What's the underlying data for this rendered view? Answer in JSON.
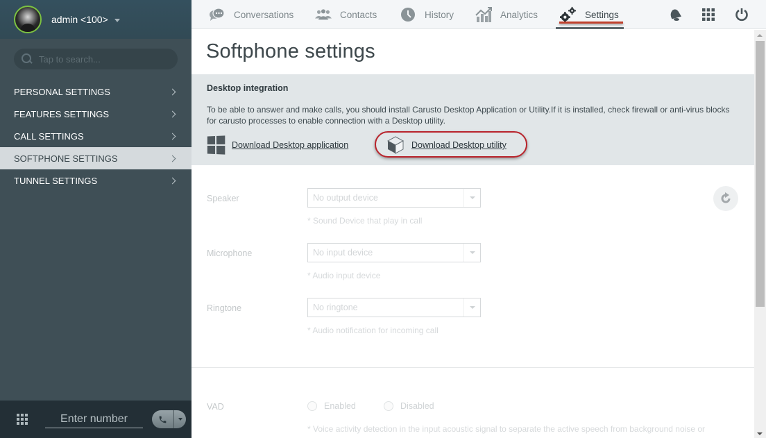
{
  "user": {
    "name": "admin <100>",
    "status_color": "#7cc242"
  },
  "search": {
    "placeholder": "Tap to search..."
  },
  "sidebar": {
    "items": [
      {
        "label": "PERSONAL SETTINGS",
        "active": false
      },
      {
        "label": "FEATURES SETTINGS",
        "active": false
      },
      {
        "label": "CALL SETTINGS",
        "active": false
      },
      {
        "label": "SOFTPHONE SETTINGS",
        "active": true
      },
      {
        "label": "TUNNEL SETTINGS",
        "active": false
      }
    ]
  },
  "dialer": {
    "placeholder": "Enter number"
  },
  "topnav": {
    "tabs": [
      {
        "label": "Conversations",
        "icon": "chat-bubbles-icon"
      },
      {
        "label": "Contacts",
        "icon": "contacts-icon"
      },
      {
        "label": "History",
        "icon": "clock-icon"
      },
      {
        "label": "Analytics",
        "icon": "analytics-icon"
      },
      {
        "label": "Settings",
        "icon": "gears-icon",
        "active": true
      }
    ],
    "accent_color": "#c0412d"
  },
  "page": {
    "title": "Softphone settings"
  },
  "integration": {
    "title": "Desktop integration",
    "description": "To be able to answer and make calls, you should install Carusto Desktop Application or Utility.If it is installed, check firewall or anti-virus blocks for carusto processes to enable connection with a Desktop utility.",
    "download_app": "Download Desktop application",
    "download_utility": "Download Desktop utility"
  },
  "fields": {
    "speaker": {
      "label": "Speaker",
      "value": "No output device",
      "hint": "* Sound Device that play in call"
    },
    "microphone": {
      "label": "Microphone",
      "value": "No input device",
      "hint": "* Audio input device"
    },
    "ringtone": {
      "label": "Ringtone",
      "value": "No ringtone",
      "hint": "* Audio notification for incoming call"
    },
    "vad": {
      "label": "VAD",
      "options": [
        "Enabled",
        "Disabled"
      ],
      "hint": "* Voice activity detection in the input acoustic signal to separate the active speech from background noise or"
    }
  }
}
